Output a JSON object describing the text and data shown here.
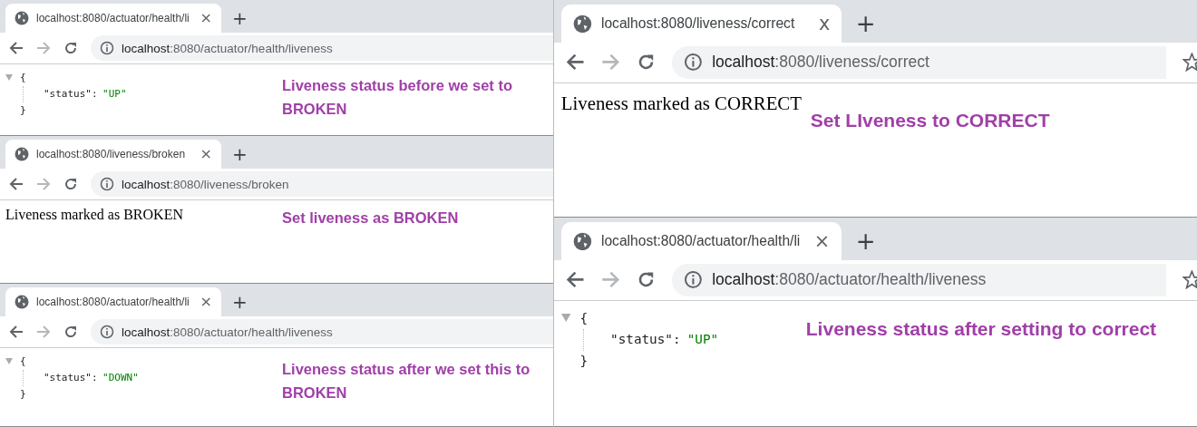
{
  "columns": [
    {
      "panels": [
        {
          "tab_title": "localhost:8080/actuator/health/li",
          "tab_close": "×",
          "new_tab": "+",
          "url_host": "localhost",
          "url_rest": ":8080/actuator/health/liveness",
          "content": {
            "kind": "json",
            "open": "{",
            "key": "\"status\"",
            "sep": ":",
            "value": "\"UP\"",
            "close": "}"
          },
          "annotation": "Liveness status before we set to BROKEN"
        },
        {
          "tab_title": "localhost:8080/liveness/broken",
          "tab_close": "×",
          "new_tab": "+",
          "url_host": "localhost",
          "url_rest": ":8080/liveness/broken",
          "content": {
            "kind": "text",
            "text": "Liveness marked as BROKEN"
          },
          "annotation": "Set liveness as BROKEN"
        },
        {
          "tab_title": "localhost:8080/actuator/health/li",
          "tab_close": "×",
          "new_tab": "+",
          "url_host": "localhost",
          "url_rest": ":8080/actuator/health/liveness",
          "content": {
            "kind": "json",
            "open": "{",
            "key": "\"status\"",
            "sep": ":",
            "value": "\"DOWN\"",
            "close": "}"
          },
          "annotation": "Liveness status after we set this to BROKEN"
        }
      ]
    },
    {
      "panels": [
        {
          "tab_title": "localhost:8080/liveness/correct",
          "tab_close": "x",
          "new_tab": "+",
          "url_host": "localhost",
          "url_rest": ":8080/liveness/correct",
          "content": {
            "kind": "text",
            "text": "Liveness marked as CORRECT"
          },
          "annotation": "Set LIveness to CORRECT"
        },
        {
          "tab_title": "localhost:8080/actuator/health/li",
          "tab_close": "×",
          "new_tab": "+",
          "url_host": "localhost",
          "url_rest": ":8080/actuator/health/liveness",
          "content": {
            "kind": "json",
            "open": "{",
            "key": "\"status\"",
            "sep": ":",
            "value": "\"UP\"",
            "close": "}"
          },
          "annotation": "Liveness status after setting to correct"
        }
      ]
    }
  ]
}
